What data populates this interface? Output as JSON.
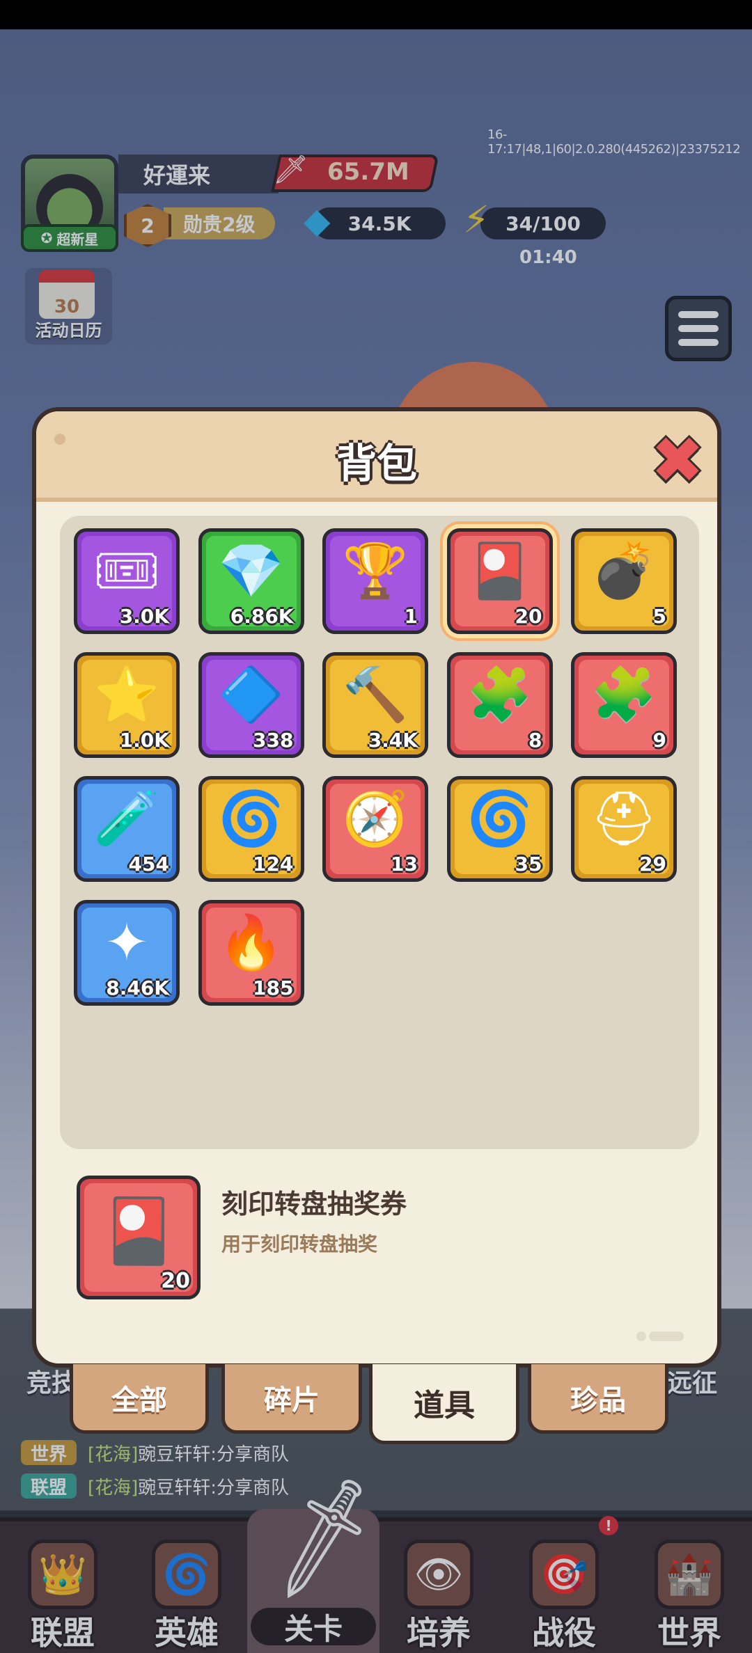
{
  "debug": "16-17:17|48,1|60|2.0.280(445262)|23375212",
  "player": {
    "name": "好運来",
    "power": "65.7M",
    "rank_tag": "超新星",
    "noble_level": "2",
    "noble_label": "勋贵2级"
  },
  "resources": {
    "gems": "34.5K",
    "energy": "34/100",
    "energy_timer": "01:40"
  },
  "calendar": {
    "day": "30",
    "label": "活动日历"
  },
  "modal": {
    "title": "背包",
    "items": [
      {
        "icon": "ticket-icon",
        "glyph": "🎟",
        "count": "3.0K",
        "color": "purple"
      },
      {
        "icon": "green-gem-icon",
        "glyph": "💎",
        "count": "6.86K",
        "color": "green"
      },
      {
        "icon": "trophy-icon",
        "glyph": "🏆",
        "count": "1",
        "color": "purple"
      },
      {
        "icon": "mystery-card-icon",
        "glyph": "🎴",
        "count": "20",
        "color": "red",
        "selected": true
      },
      {
        "icon": "bomb-icon",
        "glyph": "💣",
        "count": "5",
        "color": "gold"
      },
      {
        "icon": "star-icon",
        "glyph": "⭐",
        "count": "1.0K",
        "color": "gold"
      },
      {
        "icon": "crystal-icon",
        "glyph": "🔷",
        "count": "338",
        "color": "purple"
      },
      {
        "icon": "hammer-coin-icon",
        "glyph": "🔨",
        "count": "3.4K",
        "color": "gold"
      },
      {
        "icon": "puzzle-piece-icon",
        "glyph": "🧩",
        "count": "8",
        "color": "red"
      },
      {
        "icon": "puzzle-piece-icon",
        "glyph": "🧩",
        "count": "9",
        "color": "red"
      },
      {
        "icon": "potion-icon",
        "glyph": "🧪",
        "count": "454",
        "color": "blue"
      },
      {
        "icon": "purple-swirl-card-icon",
        "glyph": "🌀",
        "count": "124",
        "color": "gold"
      },
      {
        "icon": "compass-icon",
        "glyph": "🧭",
        "count": "13",
        "color": "red"
      },
      {
        "icon": "gold-swirl-card-icon",
        "glyph": "🌀",
        "count": "35",
        "color": "gold"
      },
      {
        "icon": "helmet-card-icon",
        "glyph": "⛑",
        "count": "29",
        "color": "gold"
      },
      {
        "icon": "cyan-star-icon",
        "glyph": "✦",
        "count": "8.46K",
        "color": "blue"
      },
      {
        "icon": "fire-gem-icon",
        "glyph": "🔥",
        "count": "185",
        "color": "red"
      }
    ],
    "detail": {
      "name": "刻印转盘抽奖券",
      "description": "用于刻印转盘抽奖",
      "count": "20",
      "glyph": "🎴"
    }
  },
  "tabs": [
    "全部",
    "碎片",
    "道具",
    "珍品"
  ],
  "side_labels": {
    "left": "竞技",
    "right": "远征"
  },
  "chat": [
    {
      "tag": "世界",
      "tag_color": "#c89a3a",
      "channel": "[花海]",
      "text": "豌豆轩轩:分享商队"
    },
    {
      "tag": "联盟",
      "tag_color": "#3fa69a",
      "channel": "[花海]",
      "text": "豌豆轩轩:分享商队"
    }
  ],
  "nav": [
    {
      "label": "联盟",
      "icon": "alliance-icon",
      "glyph": "👑"
    },
    {
      "label": "英雄",
      "icon": "hero-icon",
      "glyph": "🌀"
    },
    {
      "label": "关卡",
      "icon": "sword-icon",
      "glyph": "🗡"
    },
    {
      "label": "培养",
      "icon": "train-icon",
      "glyph": "👁"
    },
    {
      "label": "战役",
      "icon": "campaign-icon",
      "glyph": "🎯"
    },
    {
      "label": "世界",
      "icon": "world-icon",
      "glyph": "🏰"
    }
  ]
}
